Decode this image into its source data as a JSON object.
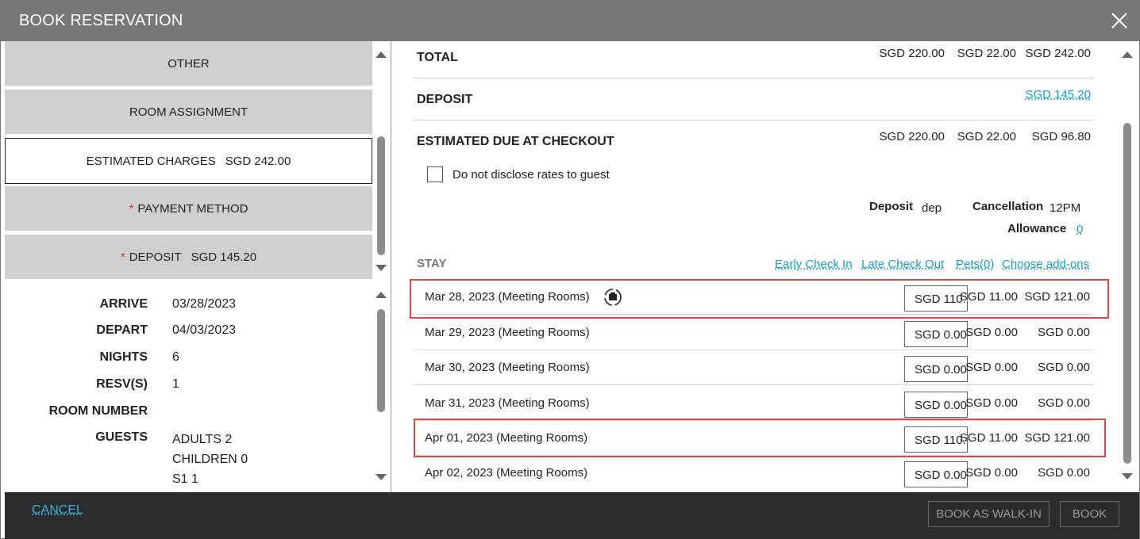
{
  "header": {
    "title": "BOOK RESERVATION"
  },
  "sections": [
    {
      "label": "OTHER",
      "required": false,
      "amount": ""
    },
    {
      "label": "ROOM ASSIGNMENT",
      "required": false,
      "amount": ""
    },
    {
      "label": "ESTIMATED CHARGES",
      "required": false,
      "amount": "SGD 242.00"
    },
    {
      "label": "PAYMENT METHOD",
      "required": true,
      "amount": ""
    },
    {
      "label": "DEPOSIT",
      "required": true,
      "amount": "SGD 145.20"
    }
  ],
  "required_mark": "*",
  "reservation": {
    "arrive_label": "ARRIVE",
    "arrive": "03/28/2023",
    "depart_label": "DEPART",
    "depart": "04/03/2023",
    "nights_label": "NIGHTS",
    "nights": "6",
    "resvs_label": "RESV(S)",
    "resvs": "1",
    "room_number_label": "ROOM NUMBER",
    "room_number": "",
    "guests_label": "GUESTS",
    "guests": [
      "ADULTS 2",
      "CHILDREN 0",
      "S1 1"
    ]
  },
  "summary": {
    "total_label": "TOTAL",
    "total": {
      "rate": "SGD 220.00",
      "tax": "SGD 22.00",
      "sum": "SGD 242.00"
    },
    "deposit_label": "DEPOSIT",
    "deposit": "SGD 145.20",
    "due_label": "ESTIMATED DUE AT CHECKOUT",
    "due": {
      "rate": "SGD 220.00",
      "tax": "SGD 22.00",
      "sum": "SGD 96.80"
    },
    "no_disclose_label": "Do not disclose rates to guest"
  },
  "policies": {
    "deposit_label": "Deposit",
    "deposit_value": "dep",
    "cancellation_label": "Cancellation",
    "cancellation_value": "12PM",
    "allowance_label": "Allowance",
    "allowance_value": "0"
  },
  "stay": {
    "label": "STAY",
    "links": [
      "Early Check In",
      "Late Check Out",
      "Pets(0)",
      "Choose add-ons"
    ],
    "rows": [
      {
        "date": "Mar 28, 2023 (Meeting Rooms)",
        "rate": "SGD 110.",
        "tax": "SGD 11.00",
        "total": "SGD 121.00"
      },
      {
        "date": "Mar 29, 2023 (Meeting Rooms)",
        "rate": "SGD 0.00",
        "tax": "SGD 0.00",
        "total": "SGD 0.00"
      },
      {
        "date": "Mar 30, 2023 (Meeting Rooms)",
        "rate": "SGD 0.00",
        "tax": "SGD 0.00",
        "total": "SGD 0.00"
      },
      {
        "date": "Mar 31, 2023 (Meeting Rooms)",
        "rate": "SGD 0.00",
        "tax": "SGD 0.00",
        "total": "SGD 0.00"
      },
      {
        "date": "Apr 01, 2023 (Meeting Rooms)",
        "rate": "SGD 110.",
        "tax": "SGD 11.00",
        "total": "SGD 121.00"
      },
      {
        "date": "Apr 02, 2023 (Meeting Rooms)",
        "rate": "SGD 0.00",
        "tax": "SGD 0.00",
        "total": "SGD 0.00"
      }
    ]
  },
  "footer": {
    "cancel": "CANCEL",
    "walk_in": "BOOK AS WALK-IN",
    "book": "BOOK"
  },
  "colors": {
    "header_bg": "#777777",
    "link": "#1a9bc4",
    "required": "#d9362b",
    "highlight": "#d64a4a",
    "footer_bg": "#2b2b2b"
  },
  "icons": {
    "close": "close-icon",
    "split": "room-move-icon"
  }
}
